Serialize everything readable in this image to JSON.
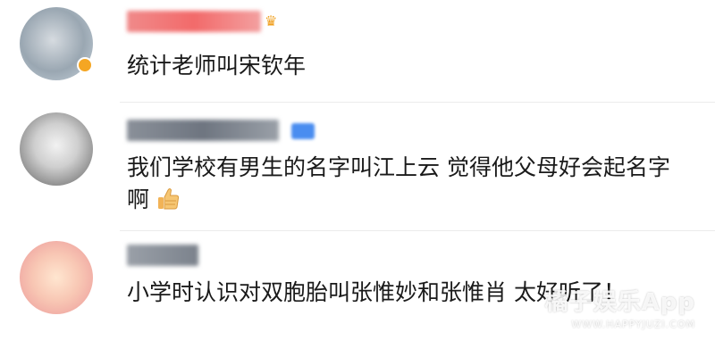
{
  "comments": [
    {
      "username": "我的D-O-",
      "text": "统计老师叫宋钦年",
      "avatar_icon": "user-avatar-icon",
      "badge": "vip-crown-icon"
    },
    {
      "username": "",
      "text": "我们学校有男生的名字叫江上云 觉得他父母好会起名字啊",
      "avatar_icon": "user-avatar-icon",
      "emoji": "thumbs-up-icon"
    },
    {
      "username": "",
      "text": "小学时认识对双胞胎叫张惟妙和张惟肖 太好听了！",
      "avatar_icon": "user-avatar-icon"
    }
  ],
  "watermark": {
    "main": "橘子娱乐App",
    "sub": "WWW.HAPPYJUZI.COM"
  },
  "colors": {
    "text": "#1a1a1a",
    "username_red": "#f26a6a",
    "username_gray": "#7b828c",
    "vip_blue": "#4a8df0",
    "badge_orange": "#f5a623"
  }
}
